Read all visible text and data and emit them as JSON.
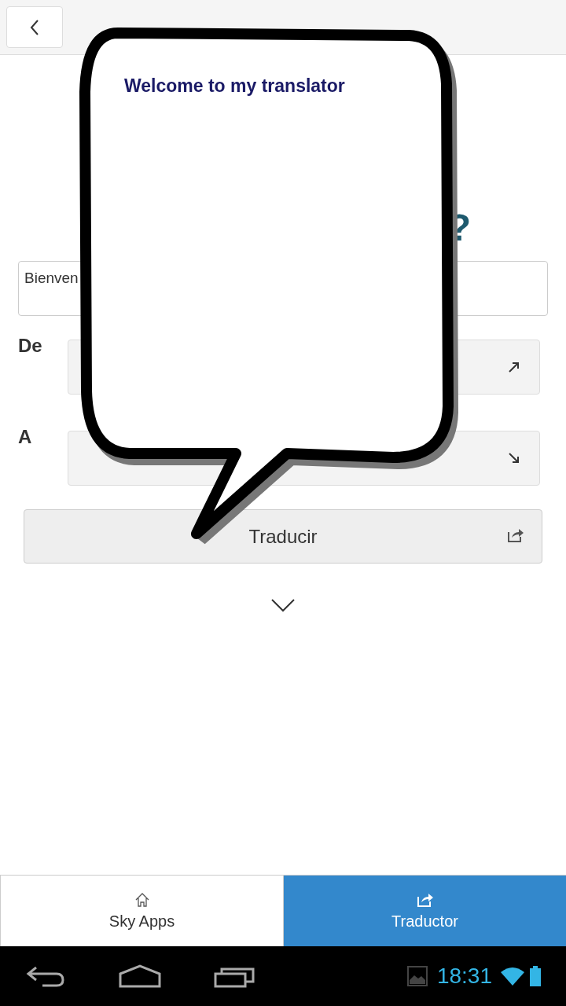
{
  "bubble": {
    "text": "Welcome to my translator"
  },
  "heading": {
    "visible_text": "?"
  },
  "input": {
    "value": "Bienven"
  },
  "selects": [
    {
      "label": "De",
      "kind": "from"
    },
    {
      "label": "A",
      "kind": "to"
    }
  ],
  "translate_button": {
    "label": "Traducir"
  },
  "tabs": [
    {
      "label": "Sky Apps",
      "kind": "home",
      "selected": false
    },
    {
      "label": "Traductor",
      "kind": "share",
      "selected": true
    }
  ],
  "system_bar": {
    "time": "18:31"
  }
}
